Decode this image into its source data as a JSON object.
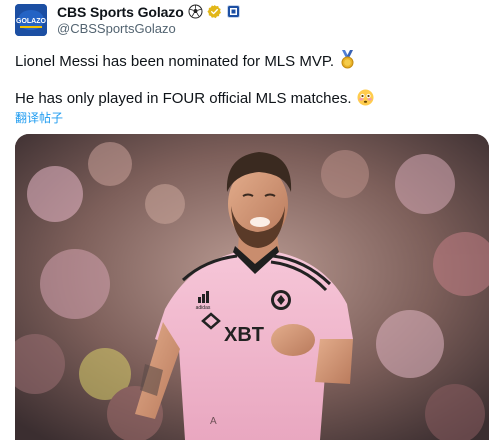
{
  "account": {
    "display_name": "CBS Sports Golazo",
    "handle": "@CBSSportsGolazo",
    "avatar_text": "GOLAZO",
    "badges": [
      "soccer-ball-icon",
      "gold-verified-icon",
      "affiliate-badge-icon"
    ]
  },
  "tweet": {
    "line1": "Lionel Messi has been nominated for MLS MVP.",
    "line1_emoji": "medal-icon",
    "line2": "He has only played in FOUR official MLS matches.",
    "line2_emoji": "flushed-face-icon",
    "translate_label": "翻译帖子"
  },
  "media": {
    "shirt_sponsor": "XBT",
    "shirt_brand": "adidas"
  },
  "colors": {
    "text": "#0f1419",
    "secondary": "#536471",
    "link": "#1d9bf0",
    "gold": "#e2b719",
    "kit_pink": "#f2b8cf"
  }
}
